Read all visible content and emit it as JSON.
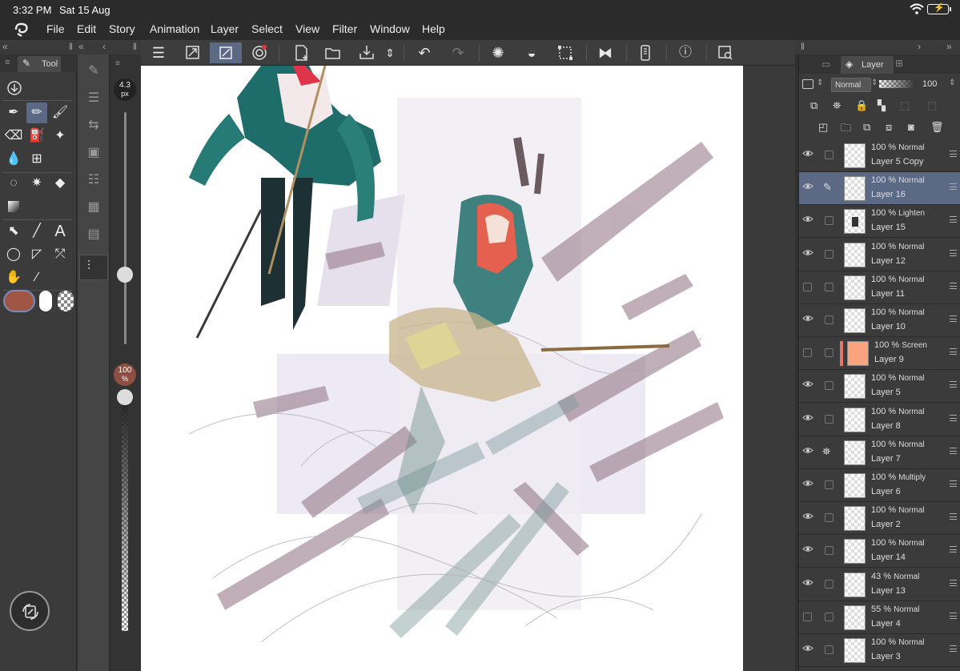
{
  "status": {
    "time": "3:32 PM",
    "date": "Sat 15 Aug",
    "battery_icon": "battery-charging-icon",
    "wifi_icon": "wifi-icon"
  },
  "menu": [
    "File",
    "Edit",
    "Story",
    "Animation",
    "Layer",
    "Select",
    "View",
    "Filter",
    "Window",
    "Help"
  ],
  "tool_panel": {
    "tab_label": "Tool"
  },
  "brush": {
    "size_value": "4.3",
    "size_unit": "px",
    "opacity_value": "100",
    "opacity_unit": "%",
    "size_fraction": 0.3,
    "opacity_fraction": 1.0
  },
  "colors": {
    "main": "#a05545",
    "sub": "#ffffff",
    "accent": "#5b6985"
  },
  "layer_panel": {
    "tab_label": "Layer",
    "blend_mode": "Normal",
    "opacity": "100",
    "layers": [
      {
        "opacity": "100 %",
        "mode": "Normal",
        "name": "Layer 5 Copy",
        "visible": true,
        "selected": false,
        "thumb": "checker"
      },
      {
        "opacity": "100 %",
        "mode": "Normal",
        "name": "Layer 16",
        "visible": true,
        "selected": true,
        "thumb": "checker"
      },
      {
        "opacity": "100 %",
        "mode": "Lighten",
        "name": "Layer 15",
        "visible": true,
        "selected": false,
        "thumb": "dark"
      },
      {
        "opacity": "100 %",
        "mode": "Normal",
        "name": "Layer 12",
        "visible": true,
        "selected": false,
        "thumb": "checker"
      },
      {
        "opacity": "100 %",
        "mode": "Normal",
        "name": "Layer 11",
        "visible": false,
        "selected": false,
        "thumb": "checker"
      },
      {
        "opacity": "100 %",
        "mode": "Normal",
        "name": "Layer 10",
        "visible": true,
        "selected": false,
        "thumb": "checker"
      },
      {
        "opacity": "100 %",
        "mode": "Screen",
        "name": "Layer 9",
        "visible": false,
        "selected": false,
        "thumb": "peach"
      },
      {
        "opacity": "100 %",
        "mode": "Normal",
        "name": "Layer 5",
        "visible": true,
        "selected": false,
        "thumb": "checker"
      },
      {
        "opacity": "100 %",
        "mode": "Normal",
        "name": "Layer 8",
        "visible": true,
        "selected": false,
        "thumb": "checker"
      },
      {
        "opacity": "100 %",
        "mode": "Normal",
        "name": "Layer 7",
        "visible": true,
        "selected": false,
        "thumb": "checker"
      },
      {
        "opacity": "100 %",
        "mode": "Multiply",
        "name": "Layer 6",
        "visible": true,
        "selected": false,
        "thumb": "checker"
      },
      {
        "opacity": "100 %",
        "mode": "Normal",
        "name": "Layer 2",
        "visible": true,
        "selected": false,
        "thumb": "checker"
      },
      {
        "opacity": "100 %",
        "mode": "Normal",
        "name": "Layer 14",
        "visible": true,
        "selected": false,
        "thumb": "checker"
      },
      {
        "opacity": "43 %",
        "mode": "Normal",
        "name": "Layer 13",
        "visible": true,
        "selected": false,
        "thumb": "checker"
      },
      {
        "opacity": "55 %",
        "mode": "Normal",
        "name": "Layer 4",
        "visible": false,
        "selected": false,
        "thumb": "checker"
      },
      {
        "opacity": "100 %",
        "mode": "Normal",
        "name": "Layer 3",
        "visible": true,
        "selected": false,
        "thumb": "checker"
      }
    ]
  }
}
